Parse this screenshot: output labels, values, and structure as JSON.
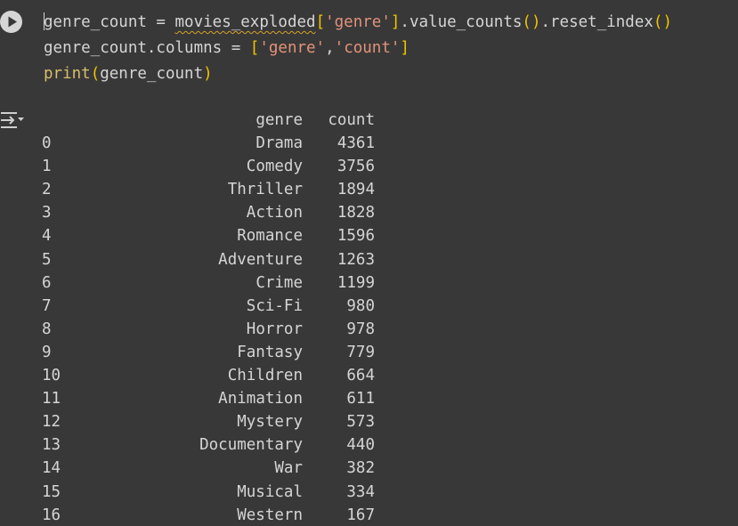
{
  "cell": {
    "run_button_icon": "play-icon",
    "code_lines": [
      [
        {
          "t": "genre_count = ",
          "c": "plain"
        },
        {
          "t": "movies_exploded",
          "c": "squig"
        },
        {
          "t": "[",
          "c": "br1"
        },
        {
          "t": "'genre'",
          "c": "str"
        },
        {
          "t": "]",
          "c": "br1"
        },
        {
          "t": ".value_counts",
          "c": "plain"
        },
        {
          "t": "(",
          "c": "br1"
        },
        {
          "t": ")",
          "c": "br1"
        },
        {
          "t": ".reset_index",
          "c": "plain"
        },
        {
          "t": "(",
          "c": "br1"
        },
        {
          "t": ")",
          "c": "br1"
        }
      ],
      [
        {
          "t": "genre_count.columns = ",
          "c": "plain"
        },
        {
          "t": "[",
          "c": "br1"
        },
        {
          "t": "'genre'",
          "c": "str"
        },
        {
          "t": ",",
          "c": "plain"
        },
        {
          "t": "'count'",
          "c": "str"
        },
        {
          "t": "]",
          "c": "br1"
        }
      ],
      [
        {
          "t": "print",
          "c": "kw"
        },
        {
          "t": "(",
          "c": "br1"
        },
        {
          "t": "genre_count",
          "c": "plain"
        },
        {
          "t": ")",
          "c": "br1"
        }
      ]
    ]
  },
  "output": {
    "toggle_icon": "output-collapse-icon",
    "columns": [
      "",
      "genre",
      "count"
    ],
    "rows": [
      [
        "0",
        "Drama",
        "4361"
      ],
      [
        "1",
        "Comedy",
        "3756"
      ],
      [
        "2",
        "Thriller",
        "1894"
      ],
      [
        "3",
        "Action",
        "1828"
      ],
      [
        "4",
        "Romance",
        "1596"
      ],
      [
        "5",
        "Adventure",
        "1263"
      ],
      [
        "6",
        "Crime",
        "1199"
      ],
      [
        "7",
        "Sci-Fi",
        "980"
      ],
      [
        "8",
        "Horror",
        "978"
      ],
      [
        "9",
        "Fantasy",
        "779"
      ],
      [
        "10",
        "Children",
        "664"
      ],
      [
        "11",
        "Animation",
        "611"
      ],
      [
        "12",
        "Mystery",
        "573"
      ],
      [
        "13",
        "Documentary",
        "440"
      ],
      [
        "14",
        "War",
        "382"
      ],
      [
        "15",
        "Musical",
        "334"
      ],
      [
        "16",
        "Western",
        "167"
      ]
    ]
  },
  "colors": {
    "background": "#383838",
    "text": "#d5d5d5",
    "string": "#e2927a",
    "bracket": "#f0c400",
    "builtin": "#d6bf6a",
    "squiggle": "#d6a02a"
  }
}
